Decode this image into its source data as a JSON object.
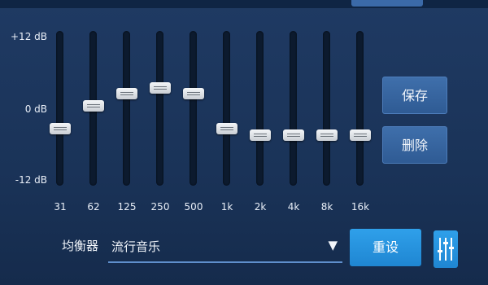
{
  "scale": {
    "max_label": "+12 dB",
    "mid_label": "0 dB",
    "min_label": "-12 dB"
  },
  "bands": [
    {
      "freq": "31",
      "gain_db": -1.4
    },
    {
      "freq": "62",
      "gain_db": 2.1
    },
    {
      "freq": "125",
      "gain_db": 4.0
    },
    {
      "freq": "250",
      "gain_db": 4.8
    },
    {
      "freq": "500",
      "gain_db": 4.0
    },
    {
      "freq": "1k",
      "gain_db": -1.4
    },
    {
      "freq": "2k",
      "gain_db": -2.3
    },
    {
      "freq": "4k",
      "gain_db": -2.3
    },
    {
      "freq": "8k",
      "gain_db": -2.3
    },
    {
      "freq": "16k",
      "gain_db": -2.3
    }
  ],
  "actions": {
    "save_label": "保存",
    "delete_label": "删除",
    "reset_label": "重设"
  },
  "equalizer": {
    "label": "均衡器",
    "preset_value": "流行音乐",
    "dropdown_arrow": "▼"
  },
  "icons": {
    "mixer": "sliders-icon"
  }
}
